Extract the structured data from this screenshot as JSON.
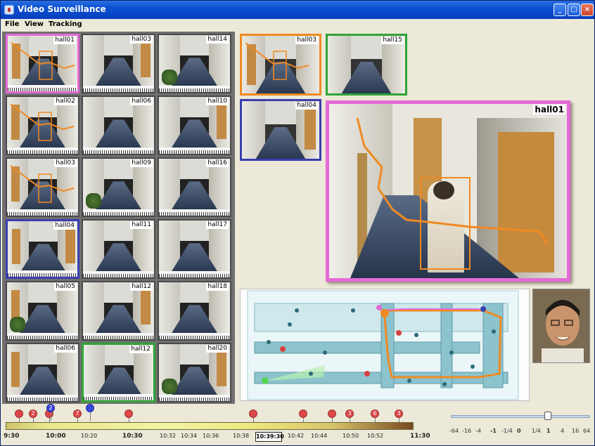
{
  "window": {
    "title": "Video Surveillance"
  },
  "menu": {
    "items": [
      "File",
      "View",
      "Tracking"
    ]
  },
  "colors": {
    "track": "#ef8a22",
    "highlight_pink": "#e46ad6",
    "highlight_blue": "#3a3fb0",
    "highlight_green": "#2fa536",
    "marker_red": "#dd4848",
    "marker_blue": "#3a48d8"
  },
  "grid_cameras": [
    {
      "label": "hall01",
      "highlight": "pink",
      "track": true
    },
    {
      "label": "hall03",
      "highlight": "none"
    },
    {
      "label": "hall14",
      "highlight": "none"
    },
    {
      "label": "hall02",
      "highlight": "none",
      "track": true
    },
    {
      "label": "hall06",
      "highlight": "none"
    },
    {
      "label": "hall10",
      "highlight": "none"
    },
    {
      "label": "hall03",
      "highlight": "none",
      "track": true
    },
    {
      "label": "hall09",
      "highlight": "none"
    },
    {
      "label": "hall16",
      "highlight": "none"
    },
    {
      "label": "hall04",
      "highlight": "blue"
    },
    {
      "label": "hall11",
      "highlight": "none"
    },
    {
      "label": "hall17",
      "highlight": "none"
    },
    {
      "label": "hall05",
      "highlight": "none"
    },
    {
      "label": "hall12",
      "highlight": "none"
    },
    {
      "label": "hall18",
      "highlight": "none"
    },
    {
      "label": "hall06",
      "highlight": "none"
    },
    {
      "label": "hall12",
      "highlight": "green"
    },
    {
      "label": "hall20",
      "highlight": "none"
    }
  ],
  "focus_cameras": [
    {
      "label": "hall03",
      "highlight": "orange"
    },
    {
      "label": "hall15",
      "highlight": "green"
    },
    {
      "label": "hall04",
      "highlight": "blue"
    }
  ],
  "main_camera": {
    "label": "hall01"
  },
  "timeline": {
    "start": "9:30",
    "end": "11:30",
    "labels": [
      {
        "text": "9:30",
        "major": true
      },
      {
        "text": "10:00",
        "major": true
      },
      {
        "text": "10:20",
        "major": false
      },
      {
        "text": "10:30",
        "major": true
      },
      {
        "text": "10:32",
        "major": false
      },
      {
        "text": "10:34",
        "major": false
      },
      {
        "text": "10:36",
        "major": false
      },
      {
        "text": "10:38",
        "major": false
      },
      {
        "text": "10:42",
        "major": false
      },
      {
        "text": "10:44",
        "major": false
      },
      {
        "text": "10:50",
        "major": false
      },
      {
        "text": "10:52",
        "major": false
      },
      {
        "text": "11:30",
        "major": true
      }
    ],
    "current_time": "10:39:30",
    "event_markers": [
      {
        "color": "red",
        "label": ""
      },
      {
        "color": "red",
        "label": "2"
      },
      {
        "color": "red",
        "label": ""
      },
      {
        "color": "blue",
        "label": "2"
      },
      {
        "color": "red",
        "label": "7"
      },
      {
        "color": "blue",
        "label": ""
      },
      {
        "color": "red",
        "label": ""
      },
      {
        "color": "red",
        "label": ""
      },
      {
        "color": "red",
        "label": ""
      },
      {
        "color": "red",
        "label": ""
      },
      {
        "color": "red",
        "label": "3"
      },
      {
        "color": "red",
        "label": "6"
      },
      {
        "color": "red",
        "label": "3"
      }
    ]
  },
  "playback_speed": {
    "labels": [
      "-64",
      "-16",
      "-4",
      "-1",
      "-1/4",
      "0",
      "1/4",
      "1",
      "4",
      "16",
      "64"
    ],
    "bold_labels": [
      "-1",
      "0",
      "1"
    ],
    "value": "1"
  }
}
